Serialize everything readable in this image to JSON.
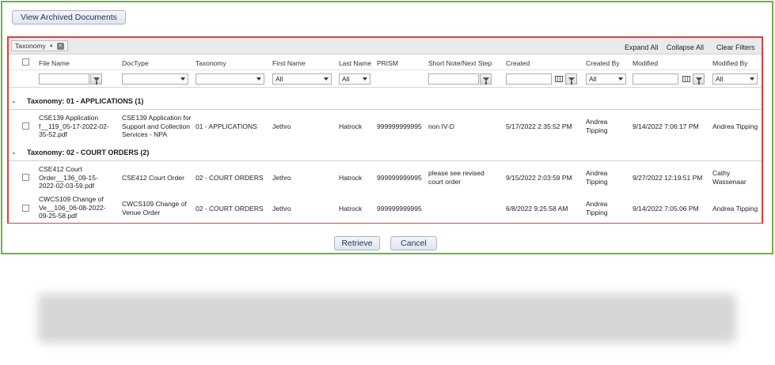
{
  "toolbar": {
    "archived_label": "View Archived Documents"
  },
  "groupbar": {
    "chip_label": "Taxonomy",
    "expand_all": "Expand All",
    "collapse_all": "Collapse All",
    "clear_filters": "Clear Filters"
  },
  "columns": {
    "file_name": "File Name",
    "doctype": "DocType",
    "taxonomy": "Taxonomy",
    "first_name": "First Name",
    "last_name": "Last Name",
    "prism": "PRISM",
    "short_note": "Short Note/Next Step",
    "created": "Created",
    "created_by": "Created By",
    "modified": "Modified",
    "modified_by": "Modified By"
  },
  "filters": {
    "first_name": "All",
    "last_name": "All",
    "created_by": "All",
    "modified_by": "All"
  },
  "groups": [
    {
      "title": "Taxonomy: 01 - APPLICATIONS (1)",
      "rows": [
        {
          "file_name": "CSE139 Application f__119_05-17-2022-02-35-52.pdf",
          "doctype": "CSE139 Application for Support and Collection Services - NPA",
          "taxonomy": "01 - APPLICATIONS",
          "first_name": "Jethro",
          "last_name": "Hatrock",
          "prism": "999999999995",
          "short_note": "non IV-D",
          "created": "5/17/2022 2:35:52 PM",
          "created_by": "Andrea Tipping",
          "modified": "9/14/2022 7:06:17 PM",
          "modified_by": "Andrea Tipping"
        }
      ]
    },
    {
      "title": "Taxonomy: 02 - COURT ORDERS (2)",
      "rows": [
        {
          "file_name": "CSE412 Court Order__136_09-15-2022-02-03-59.pdf",
          "doctype": "CSE412 Court Order",
          "taxonomy": "02 - COURT ORDERS",
          "first_name": "Jethro",
          "last_name": "Hatrock",
          "prism": "999999999995",
          "short_note": "please see revised court order",
          "created": "9/15/2022 2:03:59 PM",
          "created_by": "Andrea Tipping",
          "modified": "9/27/2022 12:19:51 PM",
          "modified_by": "Cathy Wassenaar"
        },
        {
          "file_name": "CWCS109 Change of Ve__106_06-08-2022-09-25-58.pdf",
          "doctype": "CWCS109 Change of Venue Order",
          "taxonomy": "02 - COURT ORDERS",
          "first_name": "Jethro",
          "last_name": "Hatrock",
          "prism": "999999999995",
          "short_note": "",
          "created": "6/8/2022 9:25:58 AM",
          "created_by": "Andrea Tipping",
          "modified": "9/14/2022 7:05:06 PM",
          "modified_by": "Andrea Tipping"
        }
      ]
    }
  ],
  "actions": {
    "retrieve_label": "Retrieve",
    "cancel_label": "Cancel"
  },
  "colors": {
    "frame_green": "#6cb33f",
    "grid_red": "#d9413c",
    "button_text": "#1e3356"
  }
}
